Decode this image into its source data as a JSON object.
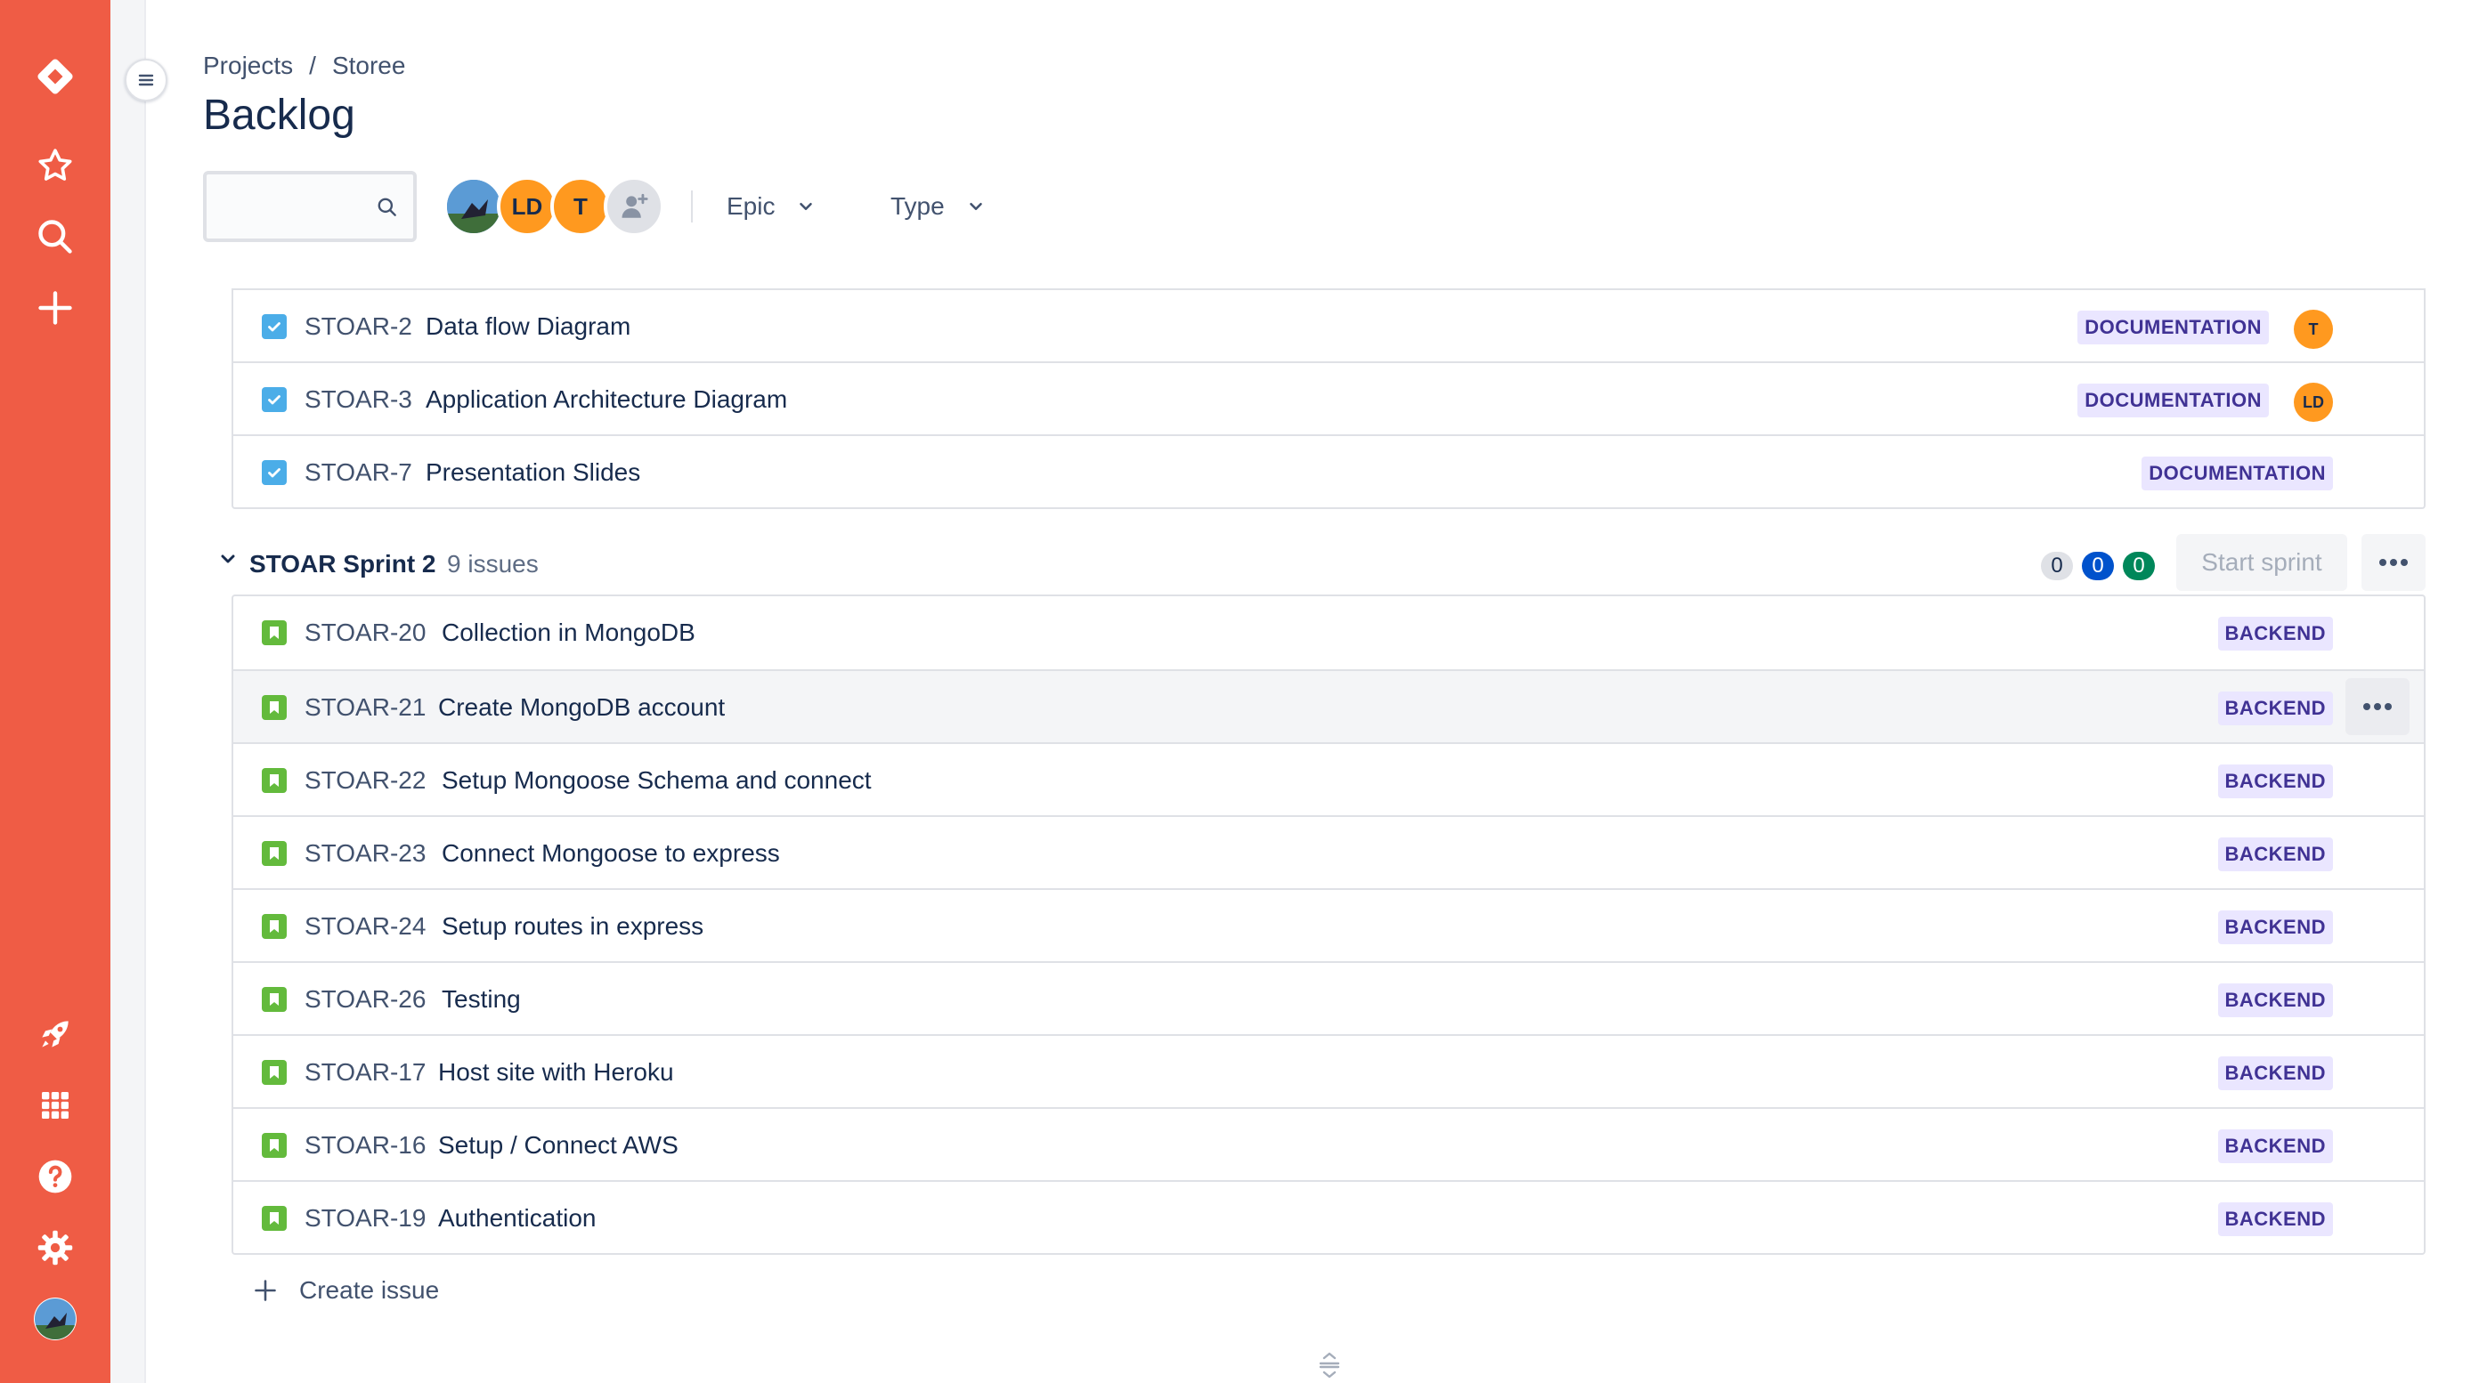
{
  "breadcrumb": {
    "projects": "Projects",
    "separator": "/",
    "project": "Storee"
  },
  "page_title": "Backlog",
  "search": {
    "placeholder": "",
    "value": ""
  },
  "avatars": [
    {
      "type": "photo",
      "label": ""
    },
    {
      "type": "initials",
      "label": "LD",
      "color": "#ff991f"
    },
    {
      "type": "initials",
      "label": "T",
      "color": "#ff991f"
    },
    {
      "type": "add-person",
      "label": ""
    }
  ],
  "filters": {
    "epic": "Epic",
    "type": "Type"
  },
  "first_sprint_issues": [
    {
      "key": "STOAR-2",
      "summary": "Data flow Diagram",
      "epic": "DOCUMENTATION",
      "assignee": "T",
      "type": "task",
      "done": true
    },
    {
      "key": "STOAR-3",
      "summary": "Application Architecture Diagram",
      "epic": "DOCUMENTATION",
      "assignee": "LD",
      "type": "task",
      "done": true
    },
    {
      "key": "STOAR-7",
      "summary": "Presentation Slides",
      "epic": "DOCUMENTATION",
      "assignee": "",
      "type": "task",
      "done": true
    }
  ],
  "sprint2": {
    "name": "STOAR Sprint 2",
    "issue_count": "9 issues",
    "todo": "0",
    "in_progress": "0",
    "done": "0",
    "start_label": "Start sprint",
    "issues": [
      {
        "key": "STOAR-20",
        "summary": "Collection in MongoDB",
        "epic": "BACKEND",
        "type": "story"
      },
      {
        "key": "STOAR-21",
        "summary": "Create MongoDB account",
        "epic": "BACKEND",
        "type": "story"
      },
      {
        "key": "STOAR-22",
        "summary": "Setup Mongoose Schema and connect",
        "epic": "BACKEND",
        "type": "story"
      },
      {
        "key": "STOAR-23",
        "summary": "Connect Mongoose to express",
        "epic": "BACKEND",
        "type": "story"
      },
      {
        "key": "STOAR-24",
        "summary": "Setup routes in express",
        "epic": "BACKEND",
        "type": "story"
      },
      {
        "key": "STOAR-26",
        "summary": "Testing",
        "epic": "BACKEND",
        "type": "story"
      },
      {
        "key": "STOAR-17",
        "summary": "Host site with Heroku",
        "epic": "BACKEND",
        "type": "story"
      },
      {
        "key": "STOAR-16",
        "summary": "Setup / Connect AWS",
        "epic": "BACKEND",
        "type": "story"
      },
      {
        "key": "STOAR-19",
        "summary": "Authentication",
        "epic": "BACKEND",
        "type": "story"
      }
    ]
  },
  "create_issue_label": "Create issue",
  "colors": {
    "nav": "#ef5c45",
    "epic_bg": "#eae6ff",
    "epic_text": "#403294",
    "task": "#4bade8",
    "story": "#63ba3c",
    "badge_blue": "#0052cc",
    "badge_green": "#00875a"
  }
}
